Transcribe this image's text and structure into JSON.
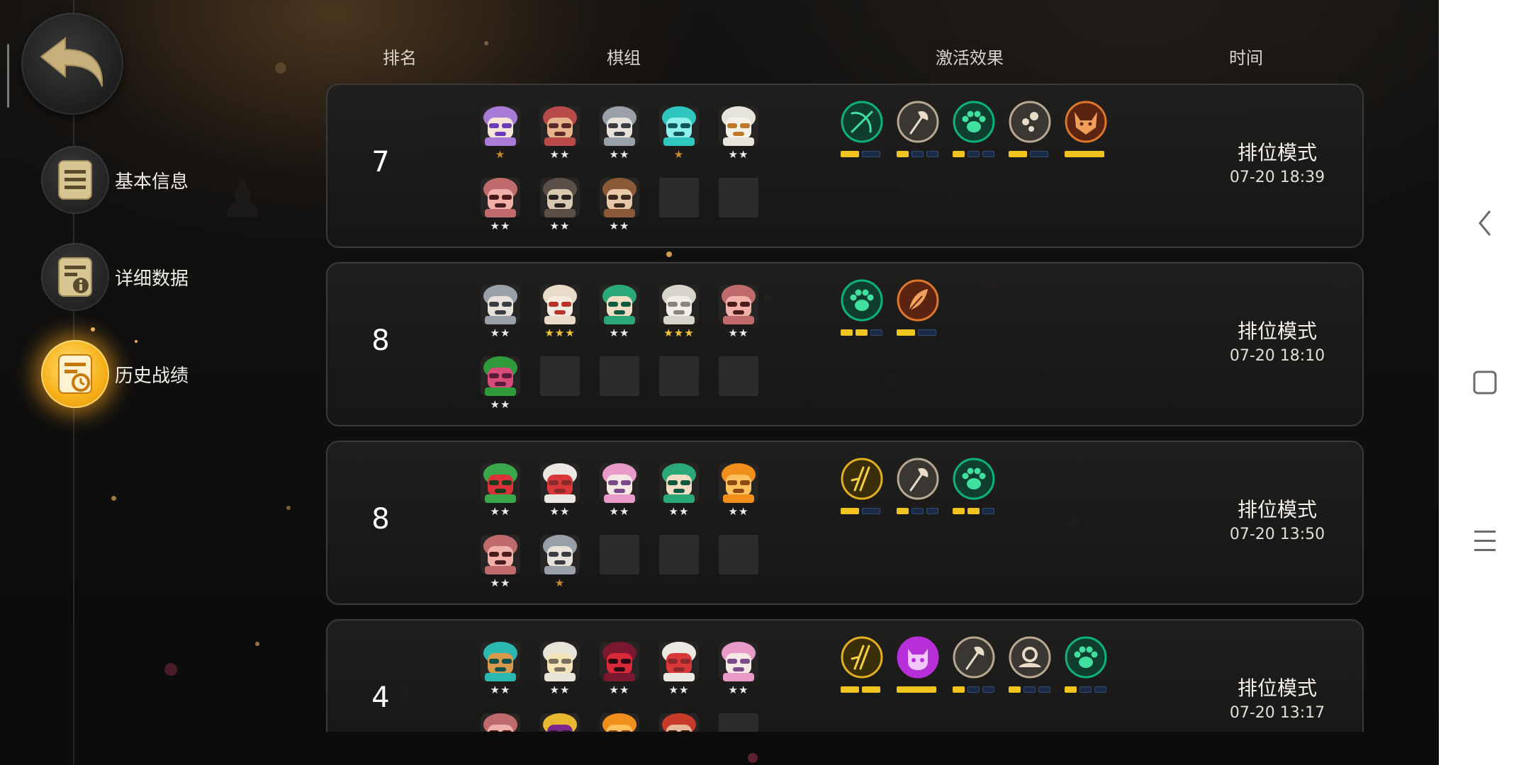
{
  "colors": {
    "accent_gold": "#f2c41f",
    "star_silver": "#ececec",
    "star_gold": "#f2c531",
    "star_bronze": "#c88a2e",
    "trait_green": "#0bb37a",
    "trait_orange": "#e0762a",
    "trait_purple": "#b62fd8",
    "trait_gray": "#8a8a8a",
    "active_glow": "#f7b21c"
  },
  "back_button": {
    "icon": "back-arrow-icon"
  },
  "sidebar": {
    "items": [
      {
        "label": "基本信息",
        "icon": "document-icon",
        "active": false
      },
      {
        "label": "详细数据",
        "icon": "document-info-icon",
        "active": false
      },
      {
        "label": "历史战绩",
        "icon": "history-record-icon",
        "active": true
      }
    ]
  },
  "headers": {
    "rank": "排名",
    "lineup": "棋组",
    "effects": "激活效果",
    "time": "时间"
  },
  "matches": [
    {
      "rank": "7",
      "mode": "排位模式",
      "time": "07-20 18:39",
      "pieces": [
        {
          "type": "purple-hair-sunglasses",
          "stars": "★",
          "star_color": "bronze"
        },
        {
          "type": "red-bandit-mask",
          "stars": "★★",
          "star_color": "silver"
        },
        {
          "type": "gray-armored-knight",
          "stars": "★★",
          "star_color": "silver"
        },
        {
          "type": "teal-robot",
          "stars": "★",
          "star_color": "bronze"
        },
        {
          "type": "white-goat",
          "stars": "★★",
          "star_color": "silver"
        },
        {
          "type": "pink-ogre",
          "stars": "★★",
          "star_color": "silver"
        },
        {
          "type": "hooded-assassin",
          "stars": "★★",
          "star_color": "silver"
        },
        {
          "type": "goggles-engineer",
          "stars": "★★",
          "star_color": "silver"
        },
        null,
        null
      ],
      "traits": [
        {
          "icon": "bow-icon",
          "color": "green",
          "bars": [
            1,
            0
          ]
        },
        {
          "icon": "axe-icon",
          "color": "gray",
          "bars": [
            1,
            0,
            0
          ]
        },
        {
          "icon": "paw-icon",
          "color": "green",
          "bars": [
            1,
            0,
            0
          ]
        },
        {
          "icon": "wisp-icon",
          "color": "gray",
          "bars": [
            1,
            0
          ]
        },
        {
          "icon": "fox-icon",
          "color": "orange",
          "bars": [
            1
          ]
        }
      ]
    },
    {
      "rank": "8",
      "mode": "排位模式",
      "time": "07-20 18:10",
      "pieces": [
        {
          "type": "gray-armored-knight",
          "stars": "★★",
          "star_color": "silver"
        },
        {
          "type": "cowboy-hat",
          "stars": "★★★",
          "star_color": "gold"
        },
        {
          "type": "green-haired-elf",
          "stars": "★★",
          "star_color": "silver"
        },
        {
          "type": "white-mammoth",
          "stars": "★★★",
          "star_color": "gold"
        },
        {
          "type": "pink-ogre",
          "stars": "★★",
          "star_color": "silver"
        },
        {
          "type": "green-demon",
          "stars": "★★",
          "star_color": "silver"
        },
        null,
        null,
        null,
        null
      ],
      "traits": [
        {
          "icon": "paw-icon",
          "color": "green",
          "bars": [
            1,
            1,
            0
          ]
        },
        {
          "icon": "feather-icon",
          "color": "orange",
          "bars": [
            1,
            0
          ]
        }
      ]
    },
    {
      "rank": "8",
      "mode": "排位模式",
      "time": "07-20 13:50",
      "pieces": [
        {
          "type": "green-goblin-goggles",
          "stars": "★★",
          "star_color": "silver"
        },
        {
          "type": "white-yeti",
          "stars": "★★",
          "star_color": "silver"
        },
        {
          "type": "pink-hair-mage",
          "stars": "★★",
          "star_color": "silver"
        },
        {
          "type": "green-haired-elf",
          "stars": "★★",
          "star_color": "silver"
        },
        {
          "type": "orange-flame",
          "stars": "★★",
          "star_color": "silver"
        },
        {
          "type": "pink-ogre",
          "stars": "★★",
          "star_color": "silver"
        },
        {
          "type": "gray-armored-knight",
          "stars": "★",
          "star_color": "bronze"
        },
        null,
        null,
        null
      ],
      "traits": [
        {
          "icon": "claw-icon",
          "color": "gold",
          "bars": [
            1,
            0
          ]
        },
        {
          "icon": "axe-icon",
          "color": "gray",
          "bars": [
            1,
            0,
            0
          ]
        },
        {
          "icon": "paw-icon",
          "color": "green",
          "bars": [
            1,
            1,
            0
          ]
        }
      ]
    },
    {
      "rank": "4",
      "mode": "排位模式",
      "time": "07-20 13:17",
      "pieces": [
        {
          "type": "teal-robot-box",
          "stars": "★★",
          "star_color": "silver"
        },
        {
          "type": "white-hat-sage",
          "stars": "★★",
          "star_color": "silver"
        },
        {
          "type": "red-horned-demon",
          "stars": "★★",
          "star_color": "silver"
        },
        {
          "type": "white-yeti",
          "stars": "★★",
          "star_color": "silver"
        },
        {
          "type": "pink-hair-mage",
          "stars": "★★",
          "star_color": "silver"
        },
        {
          "type": "pink-ogre",
          "stars": "",
          "star_color": "silver"
        },
        {
          "type": "gold-crowned-king",
          "stars": "",
          "star_color": "silver"
        },
        {
          "type": "orange-flame",
          "stars": "",
          "star_color": "silver"
        },
        {
          "type": "red-bandana-pirate",
          "stars": "",
          "star_color": "silver"
        },
        null
      ],
      "traits": [
        {
          "icon": "claw-icon",
          "color": "gold",
          "bars": [
            1,
            1
          ]
        },
        {
          "icon": "demon-icon",
          "color": "purple",
          "bars": [
            1
          ]
        },
        {
          "icon": "axe-icon",
          "color": "gray",
          "bars": [
            1,
            0,
            0
          ]
        },
        {
          "icon": "helm-icon",
          "color": "gray",
          "bars": [
            1,
            0,
            0
          ]
        },
        {
          "icon": "paw-icon",
          "color": "green",
          "bars": [
            1,
            0,
            0
          ]
        }
      ]
    }
  ],
  "system_nav": [
    {
      "icon": "nav-back-icon"
    },
    {
      "icon": "nav-home-icon"
    },
    {
      "icon": "nav-menu-icon"
    }
  ]
}
